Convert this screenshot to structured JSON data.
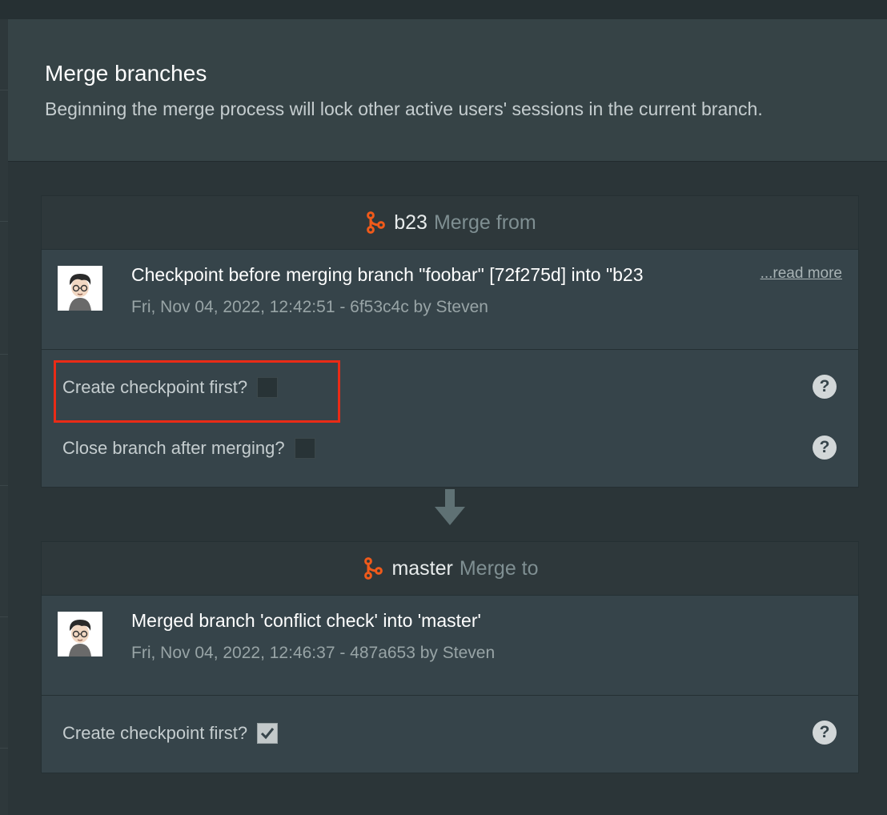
{
  "dialog": {
    "title": "Merge branches",
    "subtitle": "Beginning the merge process will lock other active users' sessions in the current branch."
  },
  "source": {
    "branch": "b23",
    "role": "Merge from",
    "commit_message": "Checkpoint before merging branch \"foobar\" [72f275d] into \"b23",
    "commit_meta": "Fri, Nov 04, 2022, 12:42:51 - 6f53c4c by Steven",
    "read_more": "...read more",
    "options": [
      {
        "label": "Create checkpoint first?",
        "checked": false
      },
      {
        "label": "Close branch after merging?",
        "checked": false
      }
    ]
  },
  "target": {
    "branch": "master",
    "role": "Merge to",
    "commit_message": "Merged branch 'conflict check' into 'master'",
    "commit_meta": "Fri, Nov 04, 2022, 12:46:37 - 487a653 by Steven",
    "options": [
      {
        "label": "Create checkpoint first?",
        "checked": true
      }
    ]
  },
  "icons": {
    "branch": "git-branch-icon",
    "help": "question-circle-icon",
    "arrow": "arrow-down-icon",
    "check": "checkmark-icon"
  },
  "colors": {
    "accent": "#f05a1a",
    "highlight": "#ea2b16"
  }
}
